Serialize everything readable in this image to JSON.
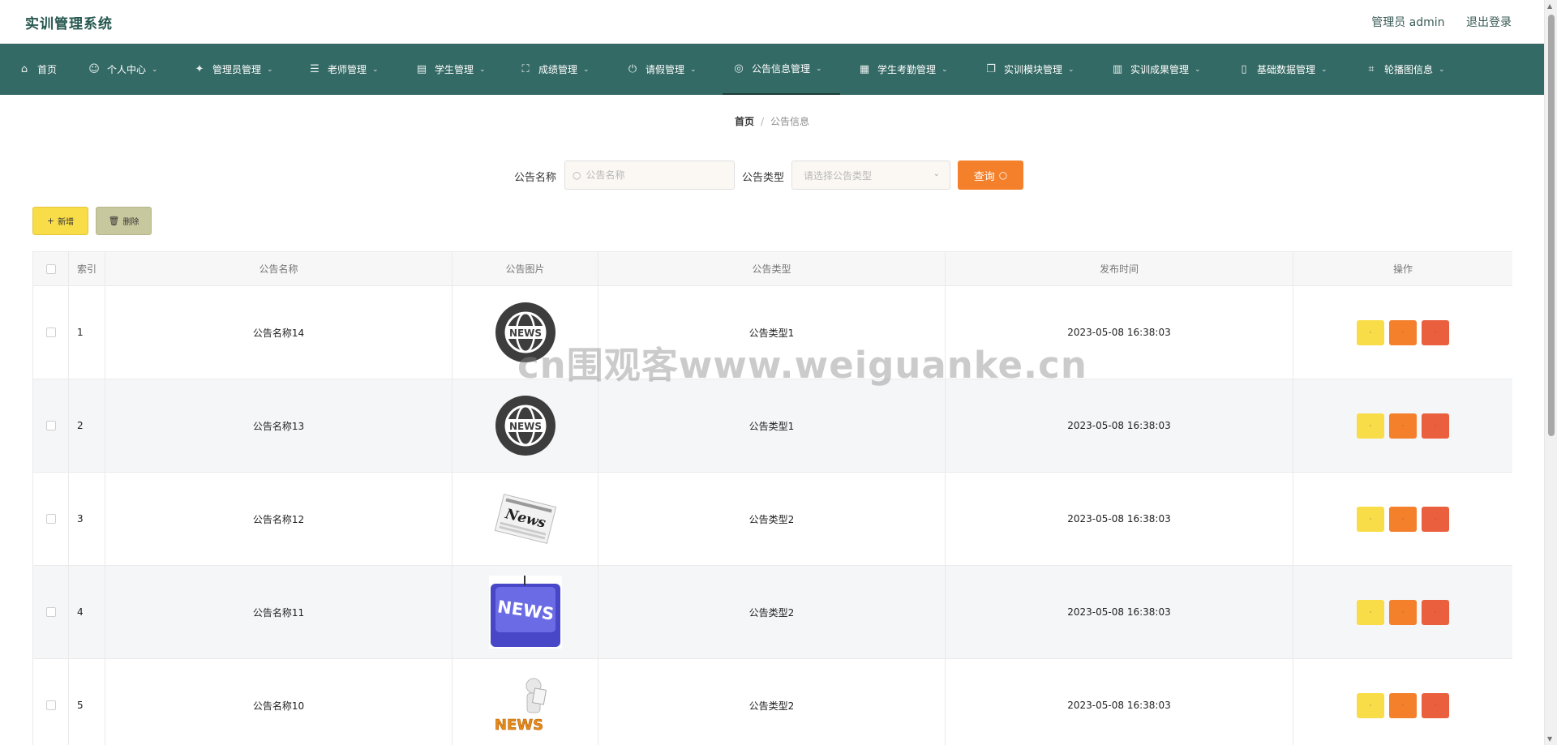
{
  "header": {
    "title": "实训管理系统",
    "user_label": "管理员 admin",
    "logout_label": "退出登录"
  },
  "nav": [
    {
      "label": "首页",
      "icon": "home-icon",
      "glyph": "⌂",
      "has_dropdown": false
    },
    {
      "label": "个人中心",
      "icon": "user-icon",
      "glyph": "☺",
      "has_dropdown": true
    },
    {
      "label": "管理员管理",
      "icon": "bell-off-icon",
      "glyph": "✦",
      "has_dropdown": true
    },
    {
      "label": "老师管理",
      "icon": "sliders-icon",
      "glyph": "☰",
      "has_dropdown": true
    },
    {
      "label": "学生管理",
      "icon": "briefcase-icon",
      "glyph": "▤",
      "has_dropdown": true
    },
    {
      "label": "成绩管理",
      "icon": "fullscreen-icon",
      "glyph": "⛶",
      "has_dropdown": true
    },
    {
      "label": "请假管理",
      "icon": "power-icon",
      "glyph": "⏻",
      "has_dropdown": true
    },
    {
      "label": "公告信息管理",
      "icon": "compass-icon",
      "glyph": "◎",
      "has_dropdown": true,
      "active": true
    },
    {
      "label": "学生考勤管理",
      "icon": "grid-icon",
      "glyph": "▦",
      "has_dropdown": true
    },
    {
      "label": "实训模块管理",
      "icon": "copy-icon",
      "glyph": "❐",
      "has_dropdown": true
    },
    {
      "label": "实训成果管理",
      "icon": "bar-chart-icon",
      "glyph": "▥",
      "has_dropdown": true
    },
    {
      "label": "基础数据管理",
      "icon": "mobile-icon",
      "glyph": "▯",
      "has_dropdown": true
    },
    {
      "label": "轮播图信息",
      "icon": "crop-icon",
      "glyph": "⌗",
      "has_dropdown": true
    }
  ],
  "breadcrumb": {
    "home": "首页",
    "separator": "/",
    "current": "公告信息"
  },
  "search": {
    "name_label": "公告名称",
    "name_placeholder": "公告名称",
    "type_label": "公告类型",
    "type_placeholder": "请选择公告类型",
    "query_label": "查询"
  },
  "actions": {
    "add_label": "新增",
    "delete_label": "删除"
  },
  "table": {
    "columns": [
      "索引",
      "公告名称",
      "公告图片",
      "公告类型",
      "发布时间",
      "操作"
    ],
    "rows": [
      {
        "index": "1",
        "name": "公告名称14",
        "image": "news-globe-dark",
        "type": "公告类型1",
        "time": "2023-05-08 16:38:03"
      },
      {
        "index": "2",
        "name": "公告名称13",
        "image": "news-globe-dark",
        "type": "公告类型1",
        "time": "2023-05-08 16:38:03"
      },
      {
        "index": "3",
        "name": "公告名称12",
        "image": "news-paper",
        "type": "公告类型2",
        "time": "2023-05-08 16:38:03"
      },
      {
        "index": "4",
        "name": "公告名称11",
        "image": "news-key-blue",
        "type": "公告类型2",
        "time": "2023-05-08 16:38:03"
      },
      {
        "index": "5",
        "name": "公告名称10",
        "image": "news-figure-orange",
        "type": "公告类型2",
        "time": "2023-05-08 16:38:03"
      }
    ],
    "op_labels": {
      "view": "·",
      "edit": "·",
      "delete": "·"
    }
  },
  "watermark": "cn围观客www.weiguanke.cn",
  "thumb_text": "NEWS",
  "colors": {
    "nav_bg": "#346a65",
    "accent_orange": "#f4802b",
    "accent_yellow": "#f8dc48",
    "accent_red": "#ea5f3e",
    "delete_btn": "#c8c89e"
  }
}
